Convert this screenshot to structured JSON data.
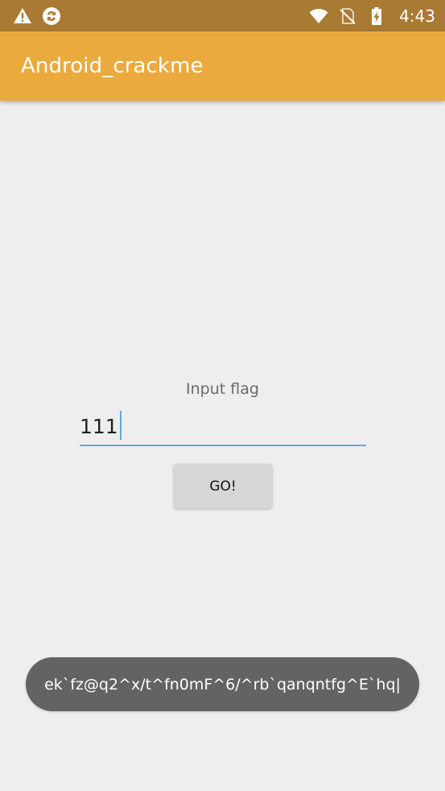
{
  "status_bar": {
    "time": "4:43",
    "left_icons": [
      "warning-icon",
      "sync-icon"
    ],
    "right_icons": [
      "wifi-icon",
      "no-sim-icon",
      "battery-charging-icon"
    ],
    "background": "#a97a33"
  },
  "app_bar": {
    "title": "Android_crackme",
    "background": "#ebaa3d"
  },
  "main": {
    "prompt_label": "Input flag",
    "input_value": "111",
    "go_button_label": "GO!",
    "accent_color": "#5fa8dd"
  },
  "toast": {
    "message": "ek`fz@q2^x/t^fn0mF^6/^rb`qanqntfg^E`hq|"
  }
}
